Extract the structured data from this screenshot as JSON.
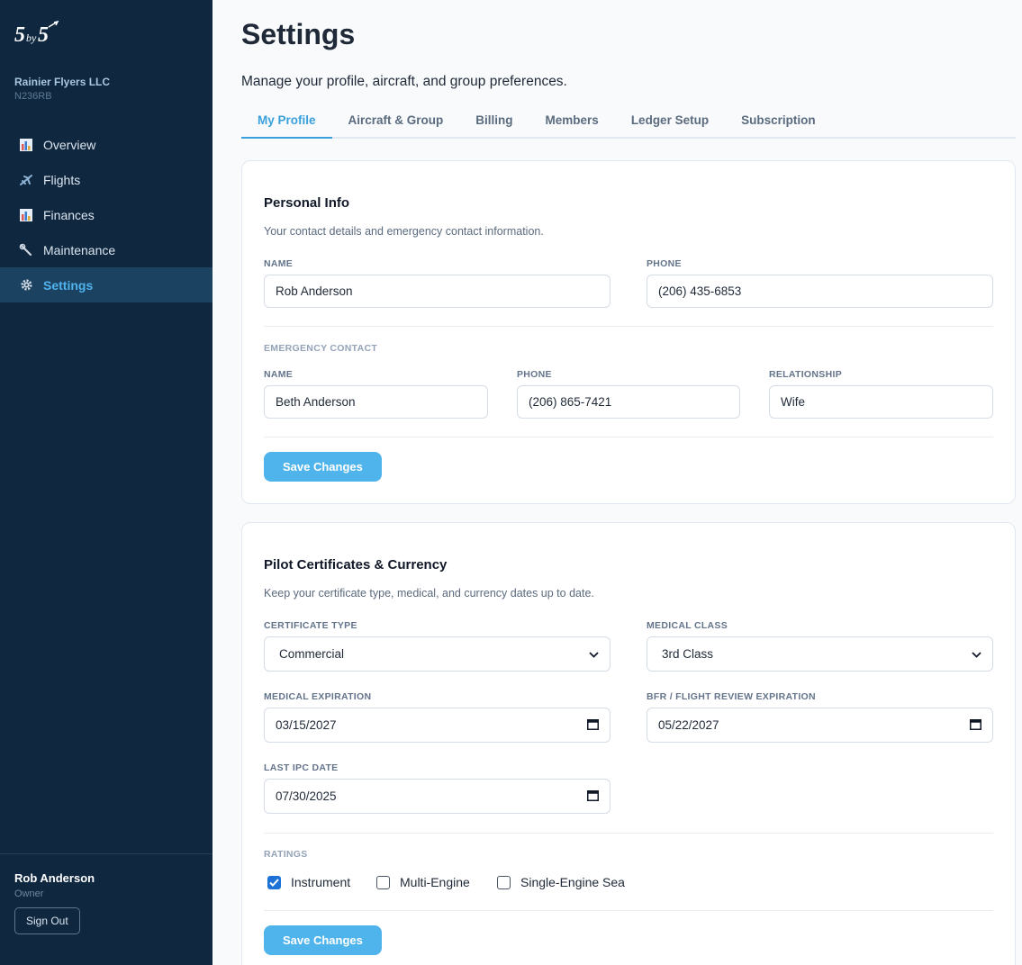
{
  "sidebar": {
    "logo_text": "5by5",
    "org_name": "Rainier Flyers LLC",
    "tail_number": "N236RB",
    "items": [
      {
        "label": "Overview",
        "icon": "bar-chart-icon"
      },
      {
        "label": "Flights",
        "icon": "airplane-icon"
      },
      {
        "label": "Finances",
        "icon": "bar-chart-icon"
      },
      {
        "label": "Maintenance",
        "icon": "wrench-icon"
      },
      {
        "label": "Settings",
        "icon": "gear-icon",
        "active": true
      }
    ],
    "user_name": "Rob Anderson",
    "user_role": "Owner",
    "sign_out_label": "Sign Out"
  },
  "header": {
    "title": "Settings",
    "subtitle": "Manage your profile, aircraft, and group preferences."
  },
  "tabs": [
    {
      "label": "My Profile",
      "active": true
    },
    {
      "label": "Aircraft & Group"
    },
    {
      "label": "Billing"
    },
    {
      "label": "Members"
    },
    {
      "label": "Ledger Setup"
    },
    {
      "label": "Subscription"
    }
  ],
  "personal_info": {
    "title": "Personal Info",
    "description": "Your contact details and emergency contact information.",
    "name_label": "NAME",
    "name_value": "Rob Anderson",
    "phone_label": "PHONE",
    "phone_value": "(206) 435-6853",
    "emergency_section_label": "EMERGENCY CONTACT",
    "emergency_name_label": "NAME",
    "emergency_name_value": "Beth Anderson",
    "emergency_phone_label": "PHONE",
    "emergency_phone_value": "(206) 865-7421",
    "relationship_label": "RELATIONSHIP",
    "relationship_value": "Wife",
    "save_label": "Save Changes"
  },
  "pilot": {
    "title": "Pilot Certificates & Currency",
    "description": "Keep your certificate type, medical, and currency dates up to date.",
    "certificate_type_label": "CERTIFICATE TYPE",
    "certificate_type_value": "Commercial",
    "medical_class_label": "MEDICAL CLASS",
    "medical_class_value": "3rd Class",
    "medical_expiration_label": "MEDICAL EXPIRATION",
    "medical_expiration_value": "03/15/2027",
    "bfr_label": "BFR / FLIGHT REVIEW EXPIRATION",
    "bfr_value": "05/22/2027",
    "last_ipc_label": "LAST IPC DATE",
    "last_ipc_value": "07/30/2025",
    "ratings_label": "RATINGS",
    "ratings": [
      {
        "label": "Instrument",
        "checked": true
      },
      {
        "label": "Multi-Engine",
        "checked": false
      },
      {
        "label": "Single-Engine Sea",
        "checked": false
      }
    ],
    "save_label": "Save Changes"
  },
  "colors": {
    "sidebar_bg": "#0f2840",
    "accent": "#4fb3ec",
    "active_nav_bg": "#1c4262"
  }
}
